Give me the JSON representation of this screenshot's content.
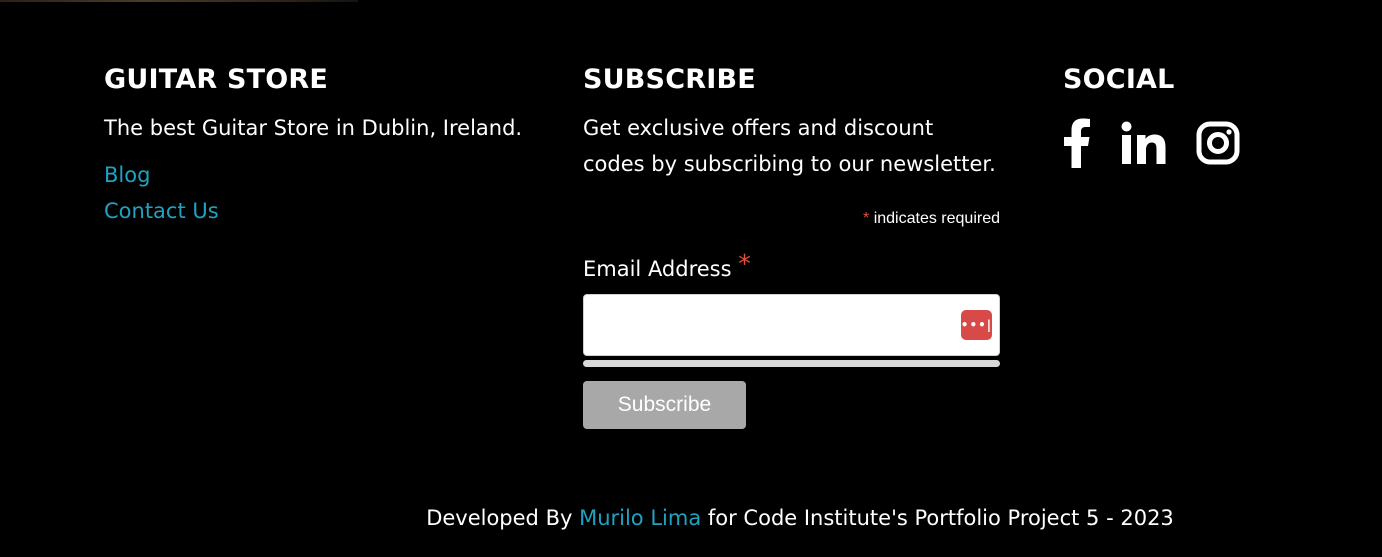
{
  "store": {
    "heading": "GUITAR STORE",
    "tagline": "The best Guitar Store in Dublin, Ireland.",
    "links": [
      {
        "label": "Blog"
      },
      {
        "label": "Contact Us"
      }
    ]
  },
  "subscribe": {
    "heading": "SUBSCRIBE",
    "description": "Get exclusive offers and discount codes by subscribing to our newsletter.",
    "required_marker": "*",
    "required_note": " indicates required",
    "email_label": "Email Address",
    "email_value": "",
    "button_label": "Subscribe"
  },
  "social": {
    "heading": "SOCIAL",
    "icons": [
      "facebook-icon",
      "linkedin-icon",
      "instagram-icon"
    ]
  },
  "footer": {
    "prefix": "Developed By ",
    "author": "Murilo Lima",
    "suffix": " for Code Institute's Portfolio Project 5 - 2023"
  },
  "colors": {
    "background": "#000000",
    "text": "#ffffff",
    "link": "#1fa2c2",
    "required": "#e0503d",
    "button": "#a8a8a8",
    "password_manager": "#d84a47"
  }
}
